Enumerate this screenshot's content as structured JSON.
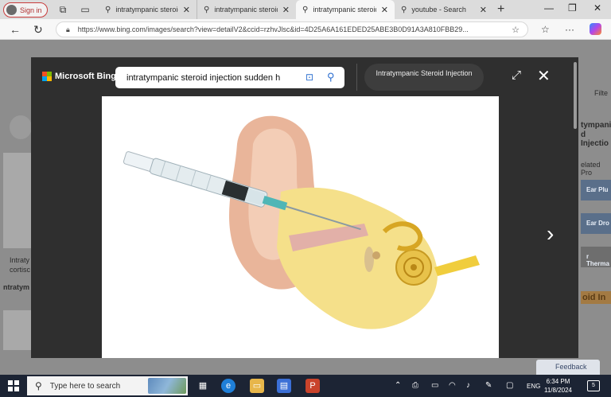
{
  "browser": {
    "profile_label": "Sign in",
    "tabs": [
      {
        "label": "intratympanic steroid",
        "active": false
      },
      {
        "label": "intratympanic steroid",
        "active": false
      },
      {
        "label": "intratympanic steroid",
        "active": true
      },
      {
        "label": "youtube - Search",
        "active": false
      }
    ],
    "url": "https://www.bing.com/images/search?view=detailV2&ccid=rzhvJlsc&id=4D25A6A161EDED25ABE3B0D91A3A810FBB29..."
  },
  "background_page": {
    "left_caption_1": "Intraty",
    "left_caption_2": "cortisc",
    "left_caption_3": "ntratym",
    "right_filter": "Filte",
    "right_title_1": "tympanic",
    "right_title_2": "d Injectio",
    "right_related": "elated Pro",
    "related_items": [
      "Ear Plu",
      "Ear Dro",
      "r Therma"
    ],
    "right_banner": "oid In",
    "feedback_label": "Feedback"
  },
  "viewer": {
    "brand": "Microsoft Bing",
    "search_query": "intratympanic steroid injection sudden h",
    "title_pill": "Intratympanic Steroid Injection"
  },
  "taskbar": {
    "search_placeholder": "Type here to search",
    "language": "ENG",
    "time": "6:34 PM",
    "date": "11/8/2024",
    "notification_count": "5"
  },
  "colors": {
    "viewer_bg": "#2f2f2f",
    "taskbar_bg": "#1c2434",
    "accent": "#2d6fd0"
  }
}
